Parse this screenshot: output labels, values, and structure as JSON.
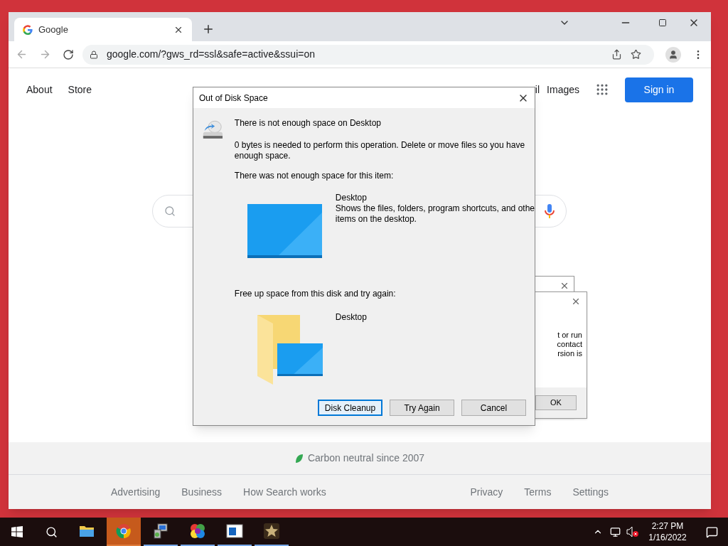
{
  "browser": {
    "tab": {
      "title": "Google"
    },
    "address": "google.com/?gws_rd=ssl&safe=active&ssui=on"
  },
  "page": {
    "top_left_links": [
      "About",
      "Store"
    ],
    "top_right_links": [
      "il",
      "Images"
    ],
    "sign_in": "Sign in",
    "footer_note": "Carbon neutral since 2007",
    "footer_left": [
      "Advertising",
      "Business",
      "How Search works"
    ],
    "footer_right": [
      "Privacy",
      "Terms",
      "Settings"
    ]
  },
  "dialog": {
    "title": "Out of Disk Space",
    "heading": "There is not enough space on Desktop",
    "message": "0 bytes is needed to perform this operation. Delete or move files so you have enough space.",
    "item_label": "There was not enough space for this item:",
    "item": {
      "name": "Desktop",
      "description": [
        "Shows the files, folders, program shortcuts, and othe",
        "items on the desktop."
      ]
    },
    "hint": "Free up space from this disk and try again:",
    "disk": {
      "name": "Desktop"
    },
    "buttons": [
      {
        "label": "Disk Cleanup",
        "selected": true
      },
      {
        "label": "Try Again",
        "selected": false
      },
      {
        "label": "Cancel",
        "selected": false
      }
    ]
  },
  "background_dialog": {
    "lines": [
      "t or run",
      "contact",
      "rsion is"
    ],
    "button": "OK"
  },
  "taskbar": {
    "apps": [
      {
        "kind": "folder",
        "selected": false,
        "running": false
      },
      {
        "kind": "chrome",
        "selected": true,
        "running": true
      },
      {
        "kind": "installer",
        "selected": false,
        "running": true
      },
      {
        "kind": "colorful",
        "selected": false,
        "running": true
      },
      {
        "kind": "window",
        "selected": false,
        "running": true
      },
      {
        "kind": "star",
        "selected": false,
        "running": true
      }
    ],
    "clock": {
      "time": "2:27 PM",
      "date": "1/16/2022"
    }
  }
}
